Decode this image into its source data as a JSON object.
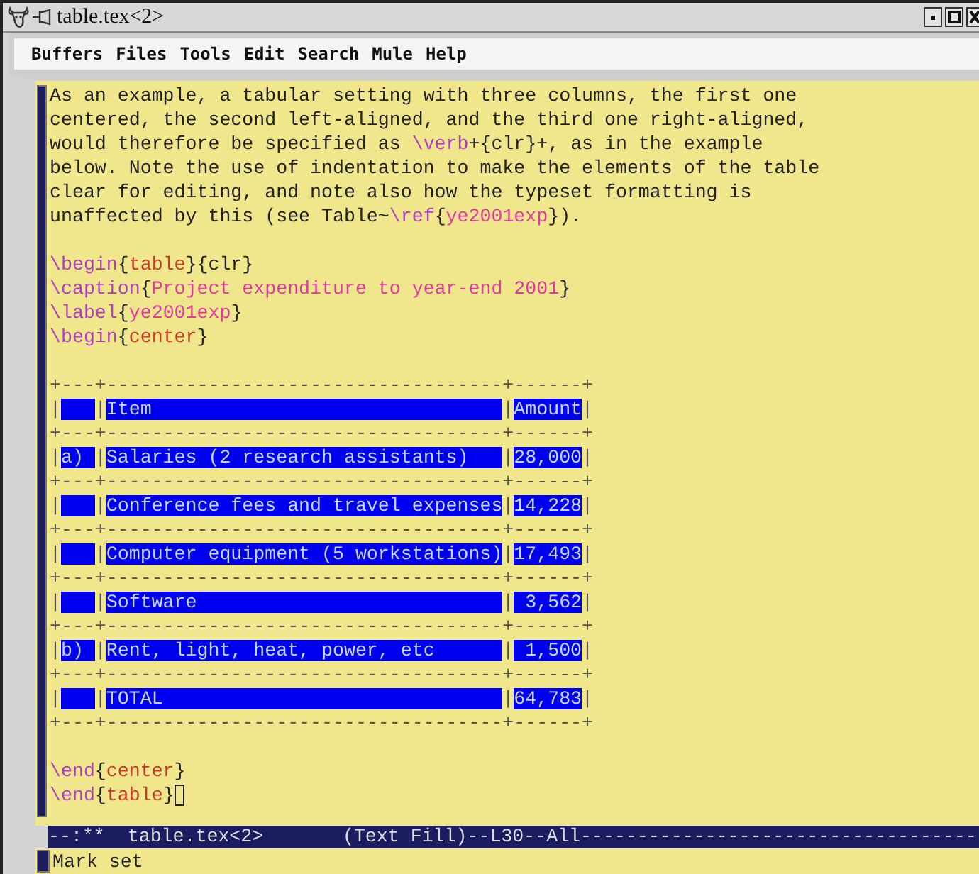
{
  "window": {
    "title": "table.tex<2>"
  },
  "menu": [
    "Buffers",
    "Files",
    "Tools",
    "Edit",
    "Search",
    "Mule",
    "Help"
  ],
  "buffer": {
    "lines": [
      {
        "kind": "text",
        "segments": [
          {
            "kind": "text",
            "text": "As an example, a tabular setting with three columns, the first one"
          }
        ]
      },
      {
        "kind": "text",
        "segments": [
          {
            "kind": "text",
            "text": "centered, the second left-aligned, and the third one right-aligned,"
          }
        ]
      },
      {
        "kind": "text",
        "segments": [
          {
            "kind": "text",
            "text": "would therefore be specified as "
          },
          {
            "kind": "command",
            "text": "\\verb"
          },
          {
            "kind": "text",
            "text": "+{clr}+, as in the example"
          }
        ]
      },
      {
        "kind": "text",
        "segments": [
          {
            "kind": "text",
            "text": "below. Note the use of indentation to make the elements of the table"
          }
        ]
      },
      {
        "kind": "text",
        "segments": [
          {
            "kind": "text",
            "text": "clear for editing, and note also how the typeset formatting is"
          }
        ]
      },
      {
        "kind": "text",
        "segments": [
          {
            "kind": "text",
            "text": "unaffected by this (see Table~"
          },
          {
            "kind": "command",
            "text": "\\ref"
          },
          {
            "kind": "text",
            "text": "{"
          },
          {
            "kind": "argument",
            "text": "ye2001exp"
          },
          {
            "kind": "text",
            "text": "})."
          }
        ]
      },
      {
        "kind": "blank"
      },
      {
        "kind": "text",
        "segments": [
          {
            "kind": "command",
            "text": "\\begin"
          },
          {
            "kind": "text",
            "text": "{"
          },
          {
            "kind": "environment",
            "text": "table"
          },
          {
            "kind": "text",
            "text": "}{clr}"
          }
        ]
      },
      {
        "kind": "text",
        "segments": [
          {
            "kind": "command",
            "text": "\\caption"
          },
          {
            "kind": "text",
            "text": "{"
          },
          {
            "kind": "argument",
            "text": "Project expenditure to year-end 2001"
          },
          {
            "kind": "text",
            "text": "}"
          }
        ]
      },
      {
        "kind": "text",
        "segments": [
          {
            "kind": "command",
            "text": "\\label"
          },
          {
            "kind": "text",
            "text": "{"
          },
          {
            "kind": "argument",
            "text": "ye2001exp"
          },
          {
            "kind": "text",
            "text": "}"
          }
        ]
      },
      {
        "kind": "text",
        "segments": [
          {
            "kind": "command",
            "text": "\\begin"
          },
          {
            "kind": "text",
            "text": "{"
          },
          {
            "kind": "environment",
            "text": "center"
          },
          {
            "kind": "text",
            "text": "}"
          }
        ]
      },
      {
        "kind": "blank"
      },
      {
        "kind": "rule",
        "text": "+---+-----------------------------------+------+"
      },
      {
        "kind": "row",
        "segments": [
          {
            "kind": "separator",
            "text": "|"
          },
          {
            "kind": "label"
          },
          {
            "kind": "separator",
            "text": "|"
          },
          {
            "kind": "item",
            "text": "Item"
          },
          {
            "kind": "separator",
            "text": "|"
          },
          {
            "kind": "amount",
            "text": "Amount"
          },
          {
            "kind": "separator",
            "text": "|"
          }
        ]
      },
      {
        "kind": "rule",
        "text": "+---+-----------------------------------+------+"
      },
      {
        "kind": "row",
        "segments": [
          {
            "kind": "separator",
            "text": "|"
          },
          {
            "kind": "label",
            "text": "a)"
          },
          {
            "kind": "separator",
            "text": "|"
          },
          {
            "kind": "item",
            "text": "Salaries (2 research assistants)"
          },
          {
            "kind": "separator",
            "text": "|"
          },
          {
            "kind": "amount",
            "text": "28,000"
          },
          {
            "kind": "separator",
            "text": "|"
          }
        ]
      },
      {
        "kind": "rule",
        "text": "+---+-----------------------------------+------+"
      },
      {
        "kind": "row",
        "segments": [
          {
            "kind": "separator",
            "text": "|"
          },
          {
            "kind": "label"
          },
          {
            "kind": "separator",
            "text": "|"
          },
          {
            "kind": "item",
            "text": "Conference fees and travel expenses"
          },
          {
            "kind": "separator",
            "text": "|"
          },
          {
            "kind": "amount",
            "text": "14,228"
          },
          {
            "kind": "separator",
            "text": "|"
          }
        ]
      },
      {
        "kind": "rule",
        "text": "+---+-----------------------------------+------+"
      },
      {
        "kind": "row",
        "segments": [
          {
            "kind": "separator",
            "text": "|"
          },
          {
            "kind": "label"
          },
          {
            "kind": "separator",
            "text": "|"
          },
          {
            "kind": "item",
            "text": "Computer equipment (5 workstations)"
          },
          {
            "kind": "separator",
            "text": "|"
          },
          {
            "kind": "amount",
            "text": "17,493"
          },
          {
            "kind": "separator",
            "text": "|"
          }
        ]
      },
      {
        "kind": "rule",
        "text": "+---+-----------------------------------+------+"
      },
      {
        "kind": "row",
        "segments": [
          {
            "kind": "separator",
            "text": "|"
          },
          {
            "kind": "label"
          },
          {
            "kind": "separator",
            "text": "|"
          },
          {
            "kind": "item",
            "text": "Software"
          },
          {
            "kind": "separator",
            "text": "|"
          },
          {
            "kind": "amount",
            "text": "3,562"
          },
          {
            "kind": "separator",
            "text": "|"
          }
        ]
      },
      {
        "kind": "rule",
        "text": "+---+-----------------------------------+------+"
      },
      {
        "kind": "row",
        "segments": [
          {
            "kind": "separator",
            "text": "|"
          },
          {
            "kind": "label",
            "text": "b)"
          },
          {
            "kind": "separator",
            "text": "|"
          },
          {
            "kind": "item",
            "text": "Rent, light, heat, power, etc"
          },
          {
            "kind": "separator",
            "text": "|"
          },
          {
            "kind": "amount",
            "text": "1,500"
          },
          {
            "kind": "separator",
            "text": "|"
          }
        ]
      },
      {
        "kind": "rule",
        "text": "+---+-----------------------------------+------+"
      },
      {
        "kind": "row",
        "segments": [
          {
            "kind": "separator",
            "text": "|"
          },
          {
            "kind": "label"
          },
          {
            "kind": "separator",
            "text": "|"
          },
          {
            "kind": "item",
            "text": "TOTAL"
          },
          {
            "kind": "separator",
            "text": "|"
          },
          {
            "kind": "amount",
            "text": "64,783"
          },
          {
            "kind": "separator",
            "text": "|"
          }
        ]
      },
      {
        "kind": "rule",
        "text": "+---+-----------------------------------+------+"
      },
      {
        "kind": "blank"
      },
      {
        "kind": "text",
        "segments": [
          {
            "kind": "command",
            "text": "\\end"
          },
          {
            "kind": "text",
            "text": "{"
          },
          {
            "kind": "environment",
            "text": "center"
          },
          {
            "kind": "text",
            "text": "}"
          }
        ]
      },
      {
        "kind": "text",
        "segments": [
          {
            "kind": "command",
            "text": "\\end"
          },
          {
            "kind": "text",
            "text": "{"
          },
          {
            "kind": "environment",
            "text": "table"
          },
          {
            "kind": "text",
            "text": "}"
          },
          {
            "kind": "cursor"
          }
        ]
      }
    ]
  },
  "mode_line": "--:**  table.tex<2>       (Text Fill)--L30--All-----------------------------------",
  "echo_area": "Mark set"
}
